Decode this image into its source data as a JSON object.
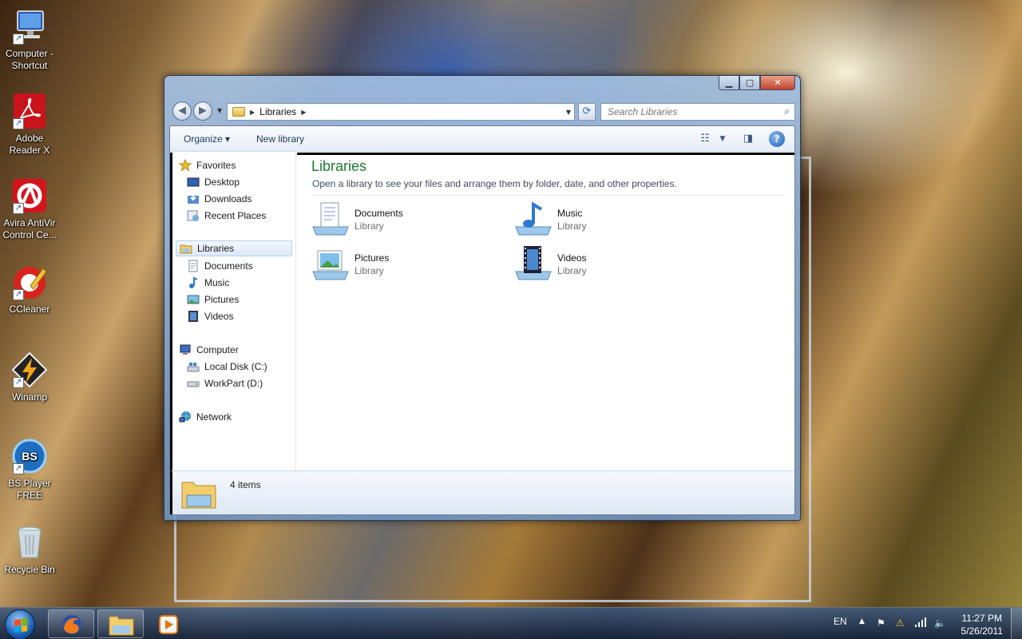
{
  "desktop": {
    "icons": [
      {
        "label": "Computer - Shortcut"
      },
      {
        "label": "Adobe Reader X"
      },
      {
        "label": "Avira AntiVir Control Ce..."
      },
      {
        "label": "CCleaner"
      },
      {
        "label": "Winamp"
      },
      {
        "label": "BS.Player FREE"
      },
      {
        "label": "Recycle Bin"
      }
    ]
  },
  "window": {
    "address": {
      "crumb": "Libraries"
    },
    "search": {
      "placeholder": "Search Libraries"
    },
    "toolbar": {
      "organize": "Organize",
      "new_library": "New library"
    },
    "nav": {
      "favorites": "Favorites",
      "desktop": "Desktop",
      "downloads": "Downloads",
      "recent": "Recent Places",
      "libraries": "Libraries",
      "documents": "Documents",
      "music": "Music",
      "pictures": "Pictures",
      "videos": "Videos",
      "computer": "Computer",
      "local_disk": "Local Disk (C:)",
      "workpart": "WorkPart (D:)",
      "network": "Network"
    },
    "main": {
      "title": "Libraries",
      "description": "Open a library to see your files and arrange them by folder, date, and other properties.",
      "items": [
        {
          "name": "Documents",
          "type": "Library"
        },
        {
          "name": "Music",
          "type": "Library"
        },
        {
          "name": "Pictures",
          "type": "Library"
        },
        {
          "name": "Videos",
          "type": "Library"
        }
      ]
    },
    "details": {
      "count": "4 items"
    }
  },
  "taskbar": {
    "language": "EN",
    "time": "11:27 PM",
    "date": "5/26/2011"
  }
}
